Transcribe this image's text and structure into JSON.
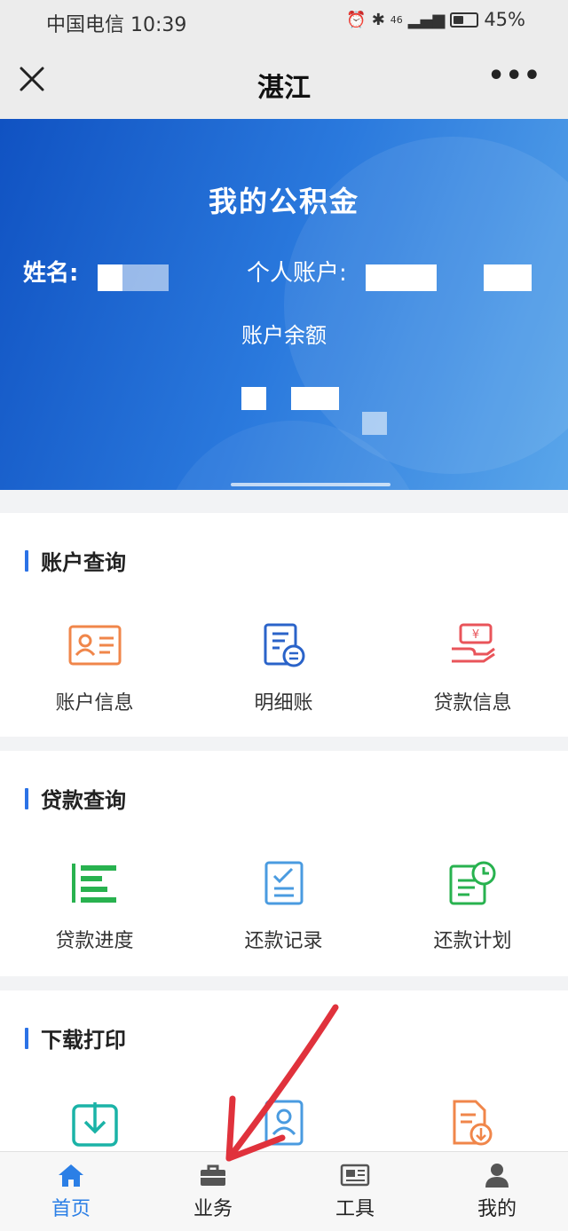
{
  "status_bar": {
    "carrier_time": "中国电信 10:39",
    "network": "46",
    "battery_pct": "45%",
    "battery_level": 0.45
  },
  "nav": {
    "title": "湛江",
    "close_icon": "close-icon",
    "more_label": "•••"
  },
  "banner": {
    "title": "我的公积金",
    "name_label": "姓名:",
    "account_label": "个人账户:",
    "balance_label": "账户余额"
  },
  "sections": [
    {
      "title": "账户查询",
      "items": [
        {
          "label": "账户信息",
          "icon": "id-card-icon"
        },
        {
          "label": "明细账",
          "icon": "ledger-icon"
        },
        {
          "label": "贷款信息",
          "icon": "loan-money-icon"
        }
      ]
    },
    {
      "title": "贷款查询",
      "items": [
        {
          "label": "贷款进度",
          "icon": "progress-bars-icon"
        },
        {
          "label": "还款记录",
          "icon": "checklist-icon"
        },
        {
          "label": "还款计划",
          "icon": "plan-clock-icon"
        }
      ]
    },
    {
      "title": "下载打印",
      "items": [
        {
          "label": "",
          "icon": "download-icon"
        },
        {
          "label": "",
          "icon": "profile-doc-icon"
        },
        {
          "label": "",
          "icon": "doc-download-icon"
        }
      ]
    }
  ],
  "tabs": [
    {
      "label": "首页",
      "icon": "home-icon",
      "active": true
    },
    {
      "label": "业务",
      "icon": "briefcase-icon",
      "active": false
    },
    {
      "label": "工具",
      "icon": "newspaper-icon",
      "active": false
    },
    {
      "label": "我的",
      "icon": "user-icon",
      "active": false
    }
  ],
  "colors": {
    "accent": "#2b72e6",
    "orange": "#f0864a",
    "red": "#e9545a",
    "green": "#28b24f",
    "teal": "#1bb3a7",
    "light_blue": "#4a9be0"
  }
}
